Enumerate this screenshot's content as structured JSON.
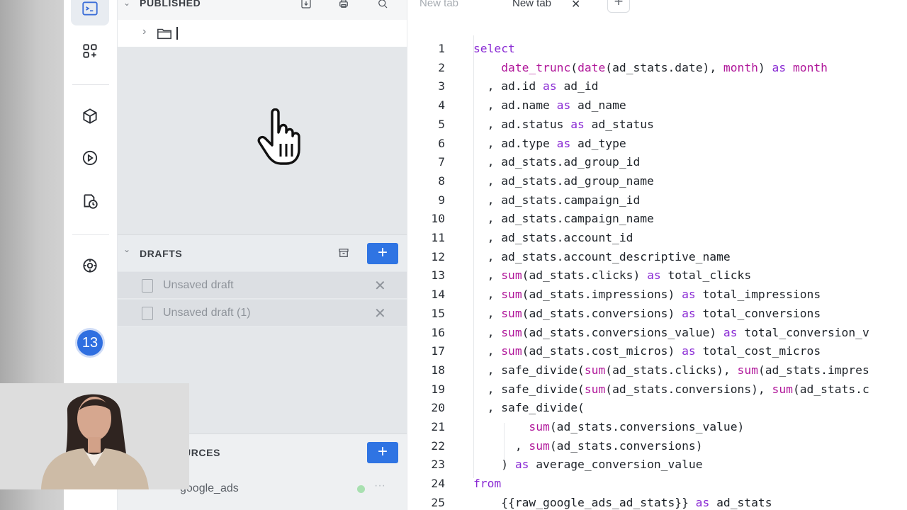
{
  "sidebar": {
    "badge_count": "13",
    "icons": [
      "terminal-icon",
      "apps-icon",
      "cube-icon",
      "play-icon",
      "schedule-icon",
      "settings-icon"
    ]
  },
  "published": {
    "title": "PUBLISHED",
    "icons": [
      "import-icon",
      "print-icon",
      "search-icon"
    ]
  },
  "drafts": {
    "title": "DRAFTS",
    "add_label": "+",
    "items": [
      {
        "label": "Unsaved draft"
      },
      {
        "label": "Unsaved draft (1)"
      }
    ]
  },
  "sources": {
    "title": "URCES",
    "add_label": "+",
    "items": [
      {
        "label": "google_ads"
      }
    ]
  },
  "tabs": [
    {
      "label": "New tab",
      "active": false
    },
    {
      "label": "New tab",
      "active": true,
      "close": "✕"
    }
  ],
  "new_tab_label": "+",
  "editor": {
    "lines": [
      {
        "n": "1",
        "segs": [
          {
            "t": "select",
            "c": "kw"
          }
        ]
      },
      {
        "n": "2",
        "segs": [
          {
            "t": "    "
          },
          {
            "t": "date_trunc",
            "c": "fn"
          },
          {
            "t": "("
          },
          {
            "t": "date",
            "c": "fn"
          },
          {
            "t": "(ad_stats.date), "
          },
          {
            "t": "month",
            "c": "fn"
          },
          {
            "t": ") "
          },
          {
            "t": "as",
            "c": "kw"
          },
          {
            "t": " "
          },
          {
            "t": "month",
            "c": "fn"
          }
        ]
      },
      {
        "n": "3",
        "segs": [
          {
            "t": "  , ad.id "
          },
          {
            "t": "as",
            "c": "kw"
          },
          {
            "t": " ad_id"
          }
        ]
      },
      {
        "n": "4",
        "segs": [
          {
            "t": "  , ad.name "
          },
          {
            "t": "as",
            "c": "kw"
          },
          {
            "t": " ad_name"
          }
        ]
      },
      {
        "n": "5",
        "segs": [
          {
            "t": "  , ad.status "
          },
          {
            "t": "as",
            "c": "kw"
          },
          {
            "t": " ad_status"
          }
        ]
      },
      {
        "n": "6",
        "segs": [
          {
            "t": "  , ad.type "
          },
          {
            "t": "as",
            "c": "kw"
          },
          {
            "t": " ad_type"
          }
        ]
      },
      {
        "n": "7",
        "segs": [
          {
            "t": "  , ad_stats.ad_group_id"
          }
        ]
      },
      {
        "n": "8",
        "segs": [
          {
            "t": "  , ad_stats.ad_group_name"
          }
        ]
      },
      {
        "n": "9",
        "segs": [
          {
            "t": "  , ad_stats.campaign_id"
          }
        ]
      },
      {
        "n": "10",
        "segs": [
          {
            "t": "  , ad_stats.campaign_name"
          }
        ]
      },
      {
        "n": "11",
        "segs": [
          {
            "t": "  , ad_stats.account_id"
          }
        ]
      },
      {
        "n": "12",
        "segs": [
          {
            "t": "  , ad_stats.account_descriptive_name"
          }
        ]
      },
      {
        "n": "13",
        "segs": [
          {
            "t": "  , "
          },
          {
            "t": "sum",
            "c": "fn"
          },
          {
            "t": "(ad_stats.clicks) "
          },
          {
            "t": "as",
            "c": "kw"
          },
          {
            "t": " total_clicks"
          }
        ]
      },
      {
        "n": "14",
        "segs": [
          {
            "t": "  , "
          },
          {
            "t": "sum",
            "c": "fn"
          },
          {
            "t": "(ad_stats.impressions) "
          },
          {
            "t": "as",
            "c": "kw"
          },
          {
            "t": " total_impressions"
          }
        ]
      },
      {
        "n": "15",
        "segs": [
          {
            "t": "  , "
          },
          {
            "t": "sum",
            "c": "fn"
          },
          {
            "t": "(ad_stats.conversions) "
          },
          {
            "t": "as",
            "c": "kw"
          },
          {
            "t": " total_conversions"
          }
        ]
      },
      {
        "n": "16",
        "segs": [
          {
            "t": "  , "
          },
          {
            "t": "sum",
            "c": "fn"
          },
          {
            "t": "(ad_stats.conversions_value) "
          },
          {
            "t": "as",
            "c": "kw"
          },
          {
            "t": " total_conversion_v"
          }
        ]
      },
      {
        "n": "17",
        "segs": [
          {
            "t": "  , "
          },
          {
            "t": "sum",
            "c": "fn"
          },
          {
            "t": "(ad_stats.cost_micros) "
          },
          {
            "t": "as",
            "c": "kw"
          },
          {
            "t": " total_cost_micros"
          }
        ]
      },
      {
        "n": "18",
        "segs": [
          {
            "t": "  , safe_divide("
          },
          {
            "t": "sum",
            "c": "fn"
          },
          {
            "t": "(ad_stats.clicks), "
          },
          {
            "t": "sum",
            "c": "fn"
          },
          {
            "t": "(ad_stats.impres"
          }
        ]
      },
      {
        "n": "19",
        "segs": [
          {
            "t": "  , safe_divide("
          },
          {
            "t": "sum",
            "c": "fn"
          },
          {
            "t": "(ad_stats.conversions), "
          },
          {
            "t": "sum",
            "c": "fn"
          },
          {
            "t": "(ad_stats.c"
          }
        ]
      },
      {
        "n": "20",
        "segs": [
          {
            "t": "  , safe_divide("
          }
        ]
      },
      {
        "n": "21",
        "segs": [
          {
            "t": "        "
          },
          {
            "t": "sum",
            "c": "fn"
          },
          {
            "t": "(ad_stats.conversions_value)"
          }
        ]
      },
      {
        "n": "22",
        "segs": [
          {
            "t": "      , "
          },
          {
            "t": "sum",
            "c": "fn"
          },
          {
            "t": "(ad_stats.conversions)"
          }
        ]
      },
      {
        "n": "23",
        "segs": [
          {
            "t": "    ) "
          },
          {
            "t": "as",
            "c": "kw"
          },
          {
            "t": " average_conversion_value"
          }
        ]
      },
      {
        "n": "24",
        "segs": [
          {
            "t": "from",
            "c": "kw"
          }
        ]
      },
      {
        "n": "25",
        "segs": [
          {
            "t": "    {{raw_google_ads_ad_stats}} "
          },
          {
            "t": "as",
            "c": "kw"
          },
          {
            "t": " ad_stats"
          }
        ]
      }
    ]
  }
}
